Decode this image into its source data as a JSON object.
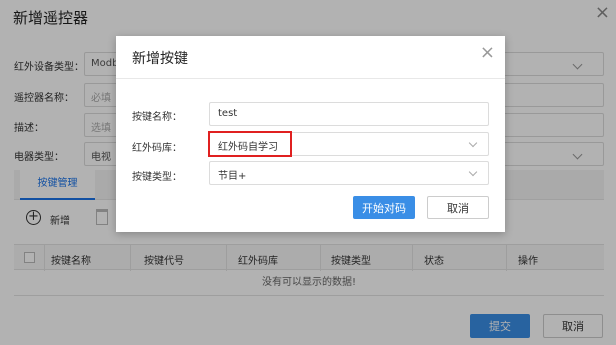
{
  "window": {
    "title": "新增遥控器",
    "close_glyph": "×"
  },
  "form": {
    "ir_device_type": {
      "label": "红外设备类型：",
      "value": "Modb"
    },
    "remote_name": {
      "label": "遥控器名称：",
      "placeholder": "必填"
    },
    "description": {
      "label": "描述：",
      "placeholder": "选填"
    },
    "appliance_type": {
      "label": "电器类型：",
      "value": "电视"
    }
  },
  "tabs": [
    {
      "label": "按键管理",
      "active": true
    }
  ],
  "toolbar": {
    "add_icon_glyph": "+",
    "add_label": "新增"
  },
  "table": {
    "columns": [
      "按键名称",
      "按键代号",
      "红外码库",
      "按键类型",
      "状态",
      "操作"
    ],
    "empty_text": "没有可以显示的数据!"
  },
  "footer": {
    "submit_label": "提交",
    "cancel_label": "取消"
  },
  "modal": {
    "title": "新增按键",
    "close_glyph": "×",
    "fields": {
      "key_name": {
        "label": "按键名称：",
        "value": "test"
      },
      "ir_code_lib": {
        "label": "红外码库：",
        "value": "红外码自学习"
      },
      "key_type": {
        "label": "按键类型：",
        "value": "节目+"
      }
    },
    "start_label": "开始对码",
    "cancel_label": "取消"
  },
  "colors": {
    "primary": "#3a8ee6",
    "highlight_border": "#e02020",
    "tab_active": "#1a73e8"
  },
  "icons": {
    "close": "close-icon",
    "chevron": "chevron-down-icon",
    "add": "add-circle-icon",
    "delete": "trash-icon"
  }
}
